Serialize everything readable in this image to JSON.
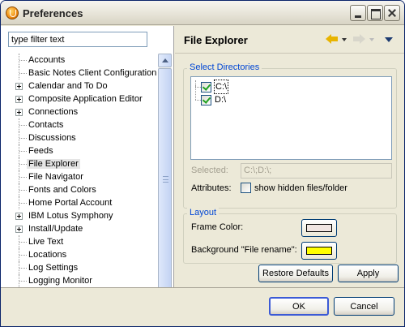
{
  "window": {
    "title": "Preferences"
  },
  "filter": {
    "placeholder": "type filter text",
    "value": "type filter text"
  },
  "tree": {
    "items": [
      {
        "label": "Accounts",
        "expandable": false
      },
      {
        "label": "Basic Notes Client Configuration",
        "expandable": false
      },
      {
        "label": "Calendar and To Do",
        "expandable": true
      },
      {
        "label": "Composite Application Editor",
        "expandable": true
      },
      {
        "label": "Connections",
        "expandable": true
      },
      {
        "label": "Contacts",
        "expandable": false
      },
      {
        "label": "Discussions",
        "expandable": false
      },
      {
        "label": "Feeds",
        "expandable": false
      },
      {
        "label": "File Explorer",
        "expandable": false,
        "selected": true
      },
      {
        "label": "File Navigator",
        "expandable": false
      },
      {
        "label": "Fonts and Colors",
        "expandable": false
      },
      {
        "label": "Home Portal Account",
        "expandable": false
      },
      {
        "label": "IBM Lotus Symphony",
        "expandable": true
      },
      {
        "label": "Install/Update",
        "expandable": true
      },
      {
        "label": "Live Text",
        "expandable": false
      },
      {
        "label": "Locations",
        "expandable": false
      },
      {
        "label": "Log Settings",
        "expandable": false
      },
      {
        "label": "Logging Monitor",
        "expandable": false
      }
    ]
  },
  "page": {
    "title": "File Explorer",
    "directories_group": {
      "legend": "Select Directories",
      "entries": [
        {
          "label": "C:\\",
          "checked": true,
          "focused": true
        },
        {
          "label": "D:\\",
          "checked": true,
          "focused": false
        }
      ],
      "selected_label": "Selected:",
      "selected_value": "C:\\;D:\\;",
      "attributes_label": "Attributes:",
      "show_hidden_label": "show hidden files/folder",
      "show_hidden_checked": false
    },
    "layout_group": {
      "legend": "Layout",
      "frame_color_label": "Frame Color:",
      "frame_color": "#f1e6e2",
      "background_label": "Background \"File rename\":",
      "background_color": "#ffff00"
    },
    "restore_defaults_label": "Restore Defaults",
    "apply_label": "Apply"
  },
  "footer": {
    "ok_label": "OK",
    "cancel_label": "Cancel"
  }
}
